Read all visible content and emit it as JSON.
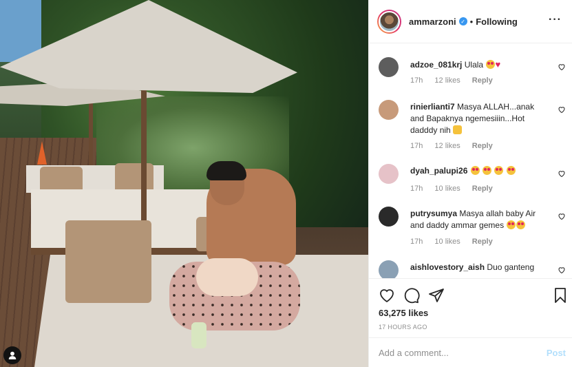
{
  "post": {
    "owner": "ammarzoni",
    "follow_status": "Following",
    "separator": "•",
    "more_icon": "more-horizontal-icon",
    "likes": "63,275 likes",
    "time": "17 HOURS AGO"
  },
  "comments": [
    {
      "user": "adzoe_081krj",
      "text": "Ulala",
      "age": "17h",
      "likes": "12 likes",
      "reply": "Reply",
      "avatar_color": "#5d5d5d"
    },
    {
      "user": "rinierlianti7",
      "text": "Masya ALLAH...anak and Bapaknya ngemesiiin...Hot dadddy nih",
      "age": "17h",
      "likes": "12 likes",
      "reply": "Reply",
      "avatar_color": "#c79a7a"
    },
    {
      "user": "dyah_palupi26",
      "text": "",
      "age": "17h",
      "likes": "10 likes",
      "reply": "Reply",
      "avatar_color": "#e6c2c8"
    },
    {
      "user": "putrysumya",
      "text": "Masya allah baby Air and daddy ammar gemes",
      "age": "17h",
      "likes": "10 likes",
      "reply": "Reply",
      "avatar_color": "#2a2a2a"
    },
    {
      "user": "aishlovestory_aish",
      "text": "Duo ganteng",
      "age": "",
      "likes": "",
      "reply": "",
      "avatar_color": "#8aa0b4"
    }
  ],
  "add_comment": {
    "placeholder": "Add a comment...",
    "post_label": "Post"
  },
  "colors": {
    "accent": "#3897f0",
    "post_disabled": "#b2dffc",
    "meta": "#8e8e8e"
  }
}
